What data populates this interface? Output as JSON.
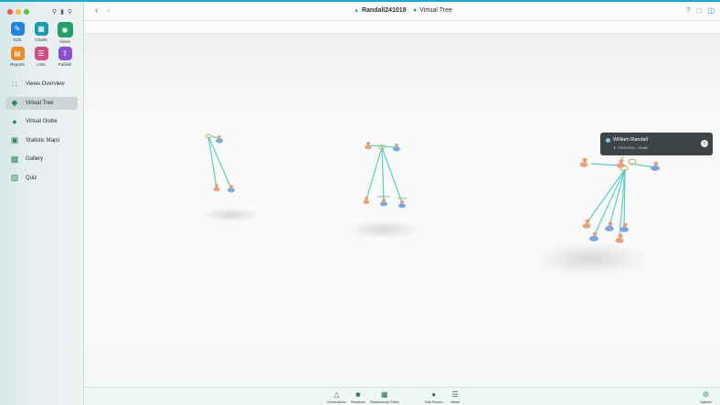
{
  "window": {
    "document_title": "Randall241018",
    "view_title": "Virtual Tree"
  },
  "sidebar": {
    "grid_buttons": [
      {
        "label": "Edit",
        "icon": "pencil-icon",
        "color": "#1f86d9"
      },
      {
        "label": "Charts",
        "icon": "charts-icon",
        "color": "#1d9ab0"
      },
      {
        "label": "Views",
        "icon": "eye-icon",
        "color": "#23a06a"
      },
      {
        "label": "Reports",
        "icon": "reports-icon",
        "color": "#e88a2c"
      },
      {
        "label": "Lists",
        "icon": "lists-icon",
        "color": "#d14d87"
      },
      {
        "label": "Publish",
        "icon": "publish-icon",
        "color": "#8b4fcf"
      }
    ],
    "nav_items": [
      {
        "label": "Views Overview",
        "icon": "grid-dots-icon"
      },
      {
        "label": "Virtual Tree",
        "icon": "cube-icon"
      },
      {
        "label": "Virtual Globe",
        "icon": "globe-icon"
      },
      {
        "label": "Statistic Maps",
        "icon": "map-icon"
      },
      {
        "label": "Gallery",
        "icon": "gallery-icon"
      },
      {
        "label": "Quiz",
        "icon": "quiz-icon"
      }
    ]
  },
  "card": {
    "name": "William Randall",
    "subtitle": "25/3/1618 – Death"
  },
  "bottom_toolbar": {
    "items": [
      {
        "label": "Generations",
        "icon": "generations-icon"
      },
      {
        "label": "Relatives",
        "icon": "relatives-icon"
      },
      {
        "label": "Relationship Paths",
        "icon": "relationship-paths-icon"
      },
      {
        "label": "Edit Person",
        "icon": "person-icon"
      },
      {
        "label": "Views",
        "icon": "views-list-icon"
      },
      {
        "label": "Options",
        "icon": "options-gear-icon"
      }
    ]
  },
  "colors": {
    "accent": "#1ba9c9",
    "line": "#58cfc0",
    "male": "#7fa6dc",
    "female": "#e4a27e"
  }
}
